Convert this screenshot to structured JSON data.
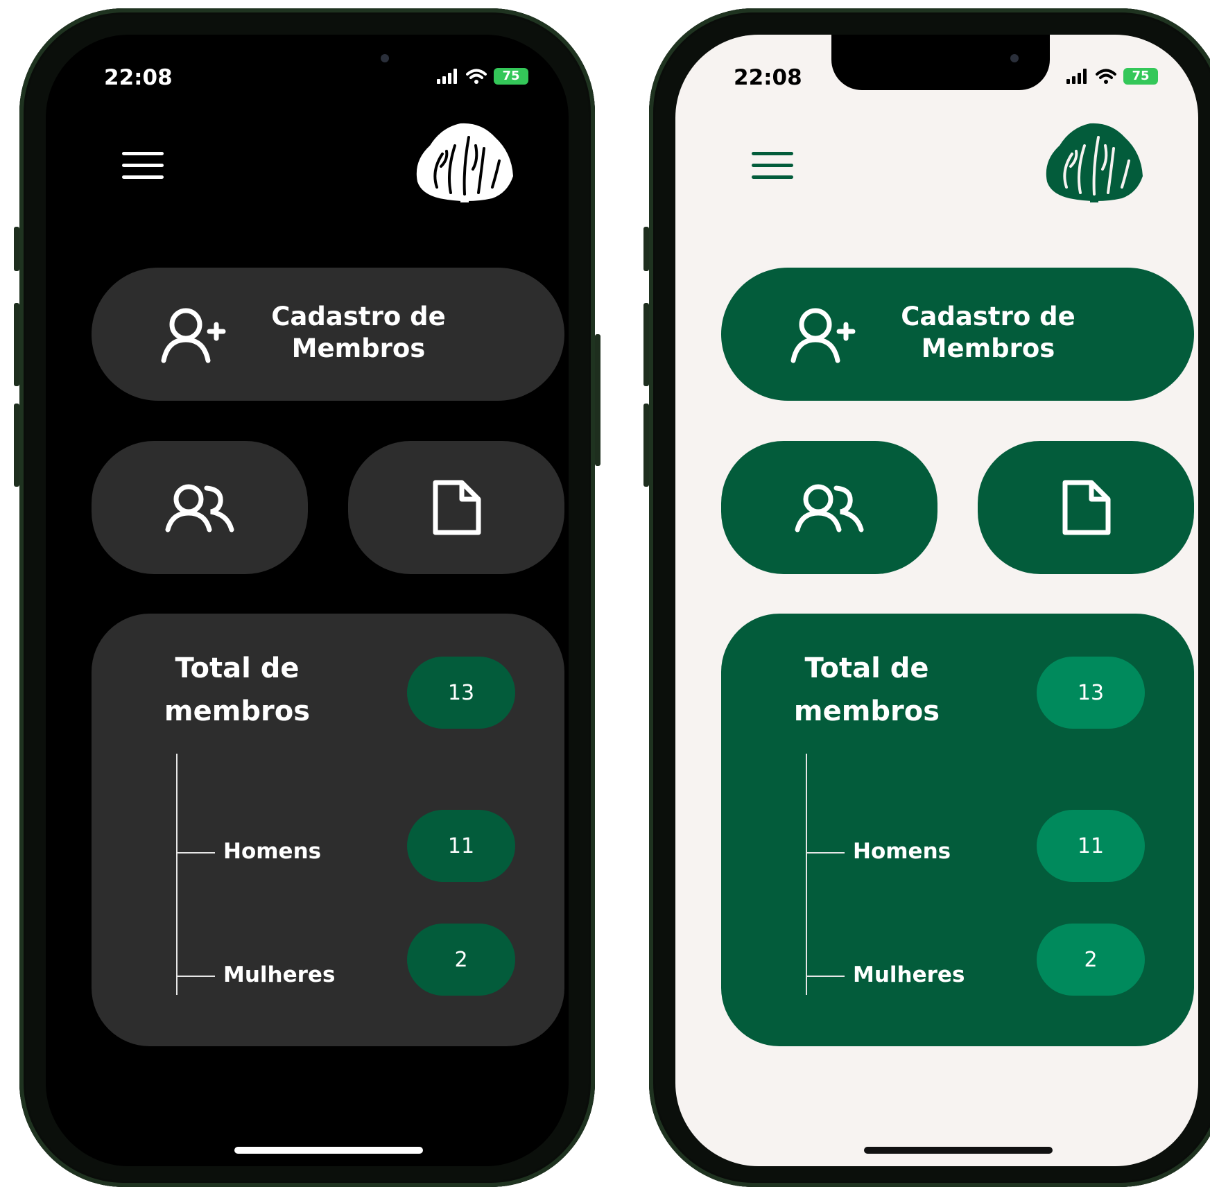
{
  "status_bar": {
    "time": "22:08",
    "battery": "75"
  },
  "icons": {
    "menu": "hamburger-menu-icon",
    "logo": "plant-logo",
    "add_user": "add-user-icon",
    "members": "users-icon",
    "document": "document-icon",
    "signal": "signal-icon",
    "wifi": "wifi-icon",
    "battery": "battery-icon"
  },
  "themes": {
    "dark": {
      "background": "#000000",
      "card": "#2d2d2d",
      "pill": "#035c3b",
      "text": "#ffffff"
    },
    "light": {
      "background": "#f7f3f1",
      "card": "#035c3b",
      "pill": "#008a5c",
      "text": "#ffffff",
      "logo": "#035c3b"
    }
  },
  "cadastro": {
    "label": "Cadastro de Membros"
  },
  "stats": {
    "title": "Total de membros",
    "total": "13",
    "men_label": "Homens",
    "men": "11",
    "women_label": "Mulheres",
    "women": "2"
  }
}
